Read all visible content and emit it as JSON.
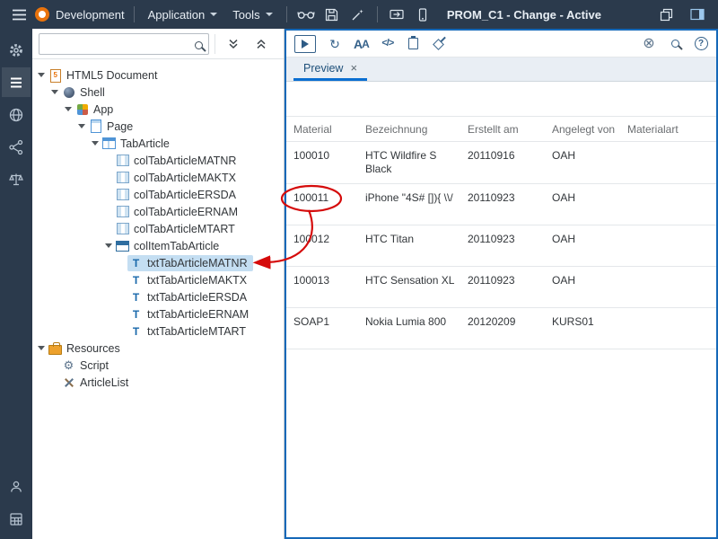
{
  "header": {
    "product": "Development",
    "menus": [
      {
        "label": "Application"
      },
      {
        "label": "Tools"
      }
    ],
    "title": "PROM_C1 - Change - Active",
    "left_icons": [
      "menu",
      "logo",
      "glasses",
      "save",
      "magic-wand",
      "deploy",
      "device-preview"
    ],
    "right_icons": [
      "copy-window",
      "layout-toggle"
    ]
  },
  "rail": {
    "icons": [
      "settings",
      "outline-editor",
      "web",
      "share",
      "legal",
      "user",
      "apps"
    ],
    "active": "outline-editor"
  },
  "outline": {
    "search": {
      "value": "",
      "placeholder": ""
    },
    "actions": [
      "collapse-all",
      "expand-all"
    ],
    "tree": [
      {
        "label": "HTML5 Document",
        "level": 0,
        "icon": "html5doc",
        "expanded": true
      },
      {
        "label": "Shell",
        "level": 1,
        "icon": "shell",
        "expanded": true
      },
      {
        "label": "App",
        "level": 2,
        "icon": "app",
        "expanded": true
      },
      {
        "label": "Page",
        "level": 3,
        "icon": "page",
        "expanded": true
      },
      {
        "label": "TabArticle",
        "level": 4,
        "icon": "table",
        "expanded": true
      },
      {
        "label": "colTabArticleMATNR",
        "level": 5,
        "icon": "column"
      },
      {
        "label": "colTabArticleMAKTX",
        "level": 5,
        "icon": "column"
      },
      {
        "label": "colTabArticleERSDA",
        "level": 5,
        "icon": "column"
      },
      {
        "label": "colTabArticleERNAM",
        "level": 5,
        "icon": "column"
      },
      {
        "label": "colTabArticleMTART",
        "level": 5,
        "icon": "column"
      },
      {
        "label": "colItemTabArticle",
        "level": 5,
        "icon": "row",
        "expanded": true
      },
      {
        "label": "txtTabArticleMATNR",
        "level": 6,
        "icon": "text",
        "selected": true
      },
      {
        "label": "txtTabArticleMAKTX",
        "level": 6,
        "icon": "text"
      },
      {
        "label": "txtTabArticleERSDA",
        "level": 6,
        "icon": "text"
      },
      {
        "label": "txtTabArticleERNAM",
        "level": 6,
        "icon": "text"
      },
      {
        "label": "txtTabArticleMTART",
        "level": 6,
        "icon": "text"
      },
      {
        "label": "Resources",
        "level": 0,
        "icon": "resources",
        "expanded": true
      },
      {
        "label": "Script",
        "level": 1,
        "icon": "script"
      },
      {
        "label": "ArticleList",
        "level": 1,
        "icon": "tools"
      }
    ]
  },
  "editor": {
    "toolbar": {
      "left_icons": [
        "run-preview",
        "refresh",
        "fonts",
        "code",
        "clipboard",
        "format-paint"
      ],
      "right_icons": [
        "close-circle",
        "search",
        "help"
      ],
      "refresh_glyph": "↻",
      "close_glyph": "⊗",
      "help_glyph": "?"
    },
    "tabs": [
      {
        "label": "Preview",
        "active": true,
        "close_symbol": "×"
      }
    ]
  },
  "preview": {
    "table": {
      "columns": [
        "Material",
        "Bezeichnung",
        "Erstellt am",
        "Angelegt von",
        "Materialart"
      ],
      "rows": [
        [
          "100010",
          "HTC Wildfire S Black",
          "20110916",
          "OAH",
          ""
        ],
        [
          "100011",
          "iPhone \"4S# []){ \\\\/",
          "20110923",
          "OAH",
          ""
        ],
        [
          "100012",
          "HTC Titan",
          "20110923",
          "OAH",
          ""
        ],
        [
          "100013",
          "HTC Sensation XL",
          "20110923",
          "OAH",
          ""
        ],
        [
          "SOAP1",
          "Nokia Lumia 800",
          "20120209",
          "KURS01",
          ""
        ]
      ]
    }
  },
  "annotation": {
    "type": "circle-and-arrow",
    "circled_cell": "100011",
    "points_to": "txtTabArticleMATNR",
    "color": "#d50b0b"
  }
}
